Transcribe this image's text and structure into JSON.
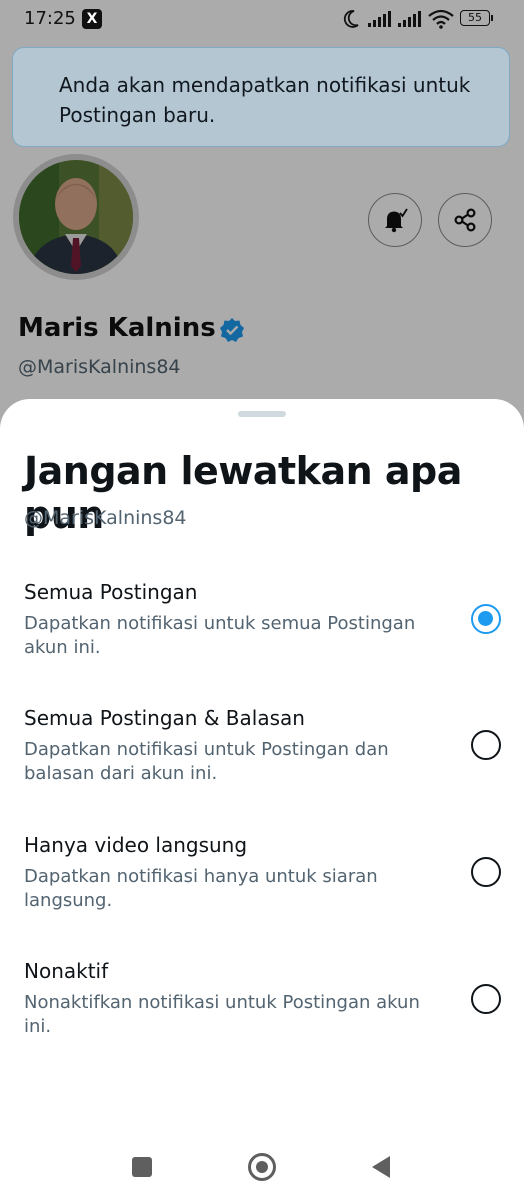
{
  "status_bar": {
    "time": "17:25",
    "app_icon": "x-logo-icon",
    "battery": "55",
    "icons": [
      "moon-icon",
      "signal-icon",
      "signal-icon",
      "wifi-icon",
      "battery-icon"
    ]
  },
  "toast": {
    "message": "Anda akan mendapatkan notifikasi untuk Postingan baru."
  },
  "profile": {
    "name": "Maris Kalnins",
    "handle": "@MarisKalnins84",
    "buttons": [
      "bell-check-icon",
      "share-icon"
    ]
  },
  "sheet": {
    "title": "Jangan lewatkan apa pun",
    "handle": "@MarisKalnins84",
    "options": [
      {
        "title": "Semua Postingan",
        "desc": "Dapatkan notifikasi untuk semua Postingan akun ini.",
        "selected": true
      },
      {
        "title": "Semua Postingan & Balasan",
        "desc": "Dapatkan notifikasi untuk Postingan dan balasan dari akun ini.",
        "selected": false
      },
      {
        "title": "Hanya video langsung",
        "desc": "Dapatkan notifikasi hanya untuk siaran langsung.",
        "selected": false
      },
      {
        "title": "Nonaktif",
        "desc": "Nonaktifkan notifikasi untuk Postingan akun ini.",
        "selected": false
      }
    ]
  },
  "nav": {
    "icons": [
      "recent-apps-icon",
      "home-icon",
      "back-icon"
    ]
  },
  "colors": {
    "accent": "#1d9bf0",
    "secondary_text": "#536471",
    "toast_bg": "#b3c6d2"
  }
}
